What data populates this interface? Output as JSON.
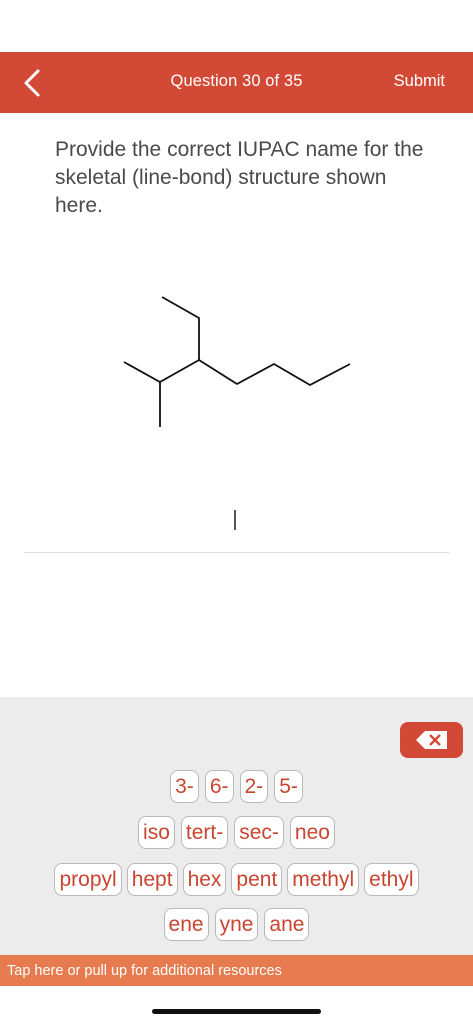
{
  "header": {
    "title": "Question 30 of 35",
    "submit_label": "Submit",
    "back_icon": "chevron-left-icon",
    "background_color": "#d24a35"
  },
  "question": {
    "prompt": "Provide the correct IUPAC name for the skeletal (line-bond) structure shown here."
  },
  "answer": {
    "value": ""
  },
  "keyboard": {
    "delete_icon": "backspace-x-icon",
    "rows": [
      [
        "3-",
        "6-",
        "2-",
        "5-"
      ],
      [
        "iso",
        "tert-",
        "sec-",
        "neo"
      ],
      [
        "propyl",
        "hept",
        "hex",
        "pent",
        "methyl",
        "ethyl"
      ],
      [
        "ene",
        "yne",
        "ane"
      ]
    ],
    "key_text_color": "#c94530"
  },
  "resources": {
    "label": "Tap here or pull up for additional resources",
    "background_color": "#e77b50"
  }
}
